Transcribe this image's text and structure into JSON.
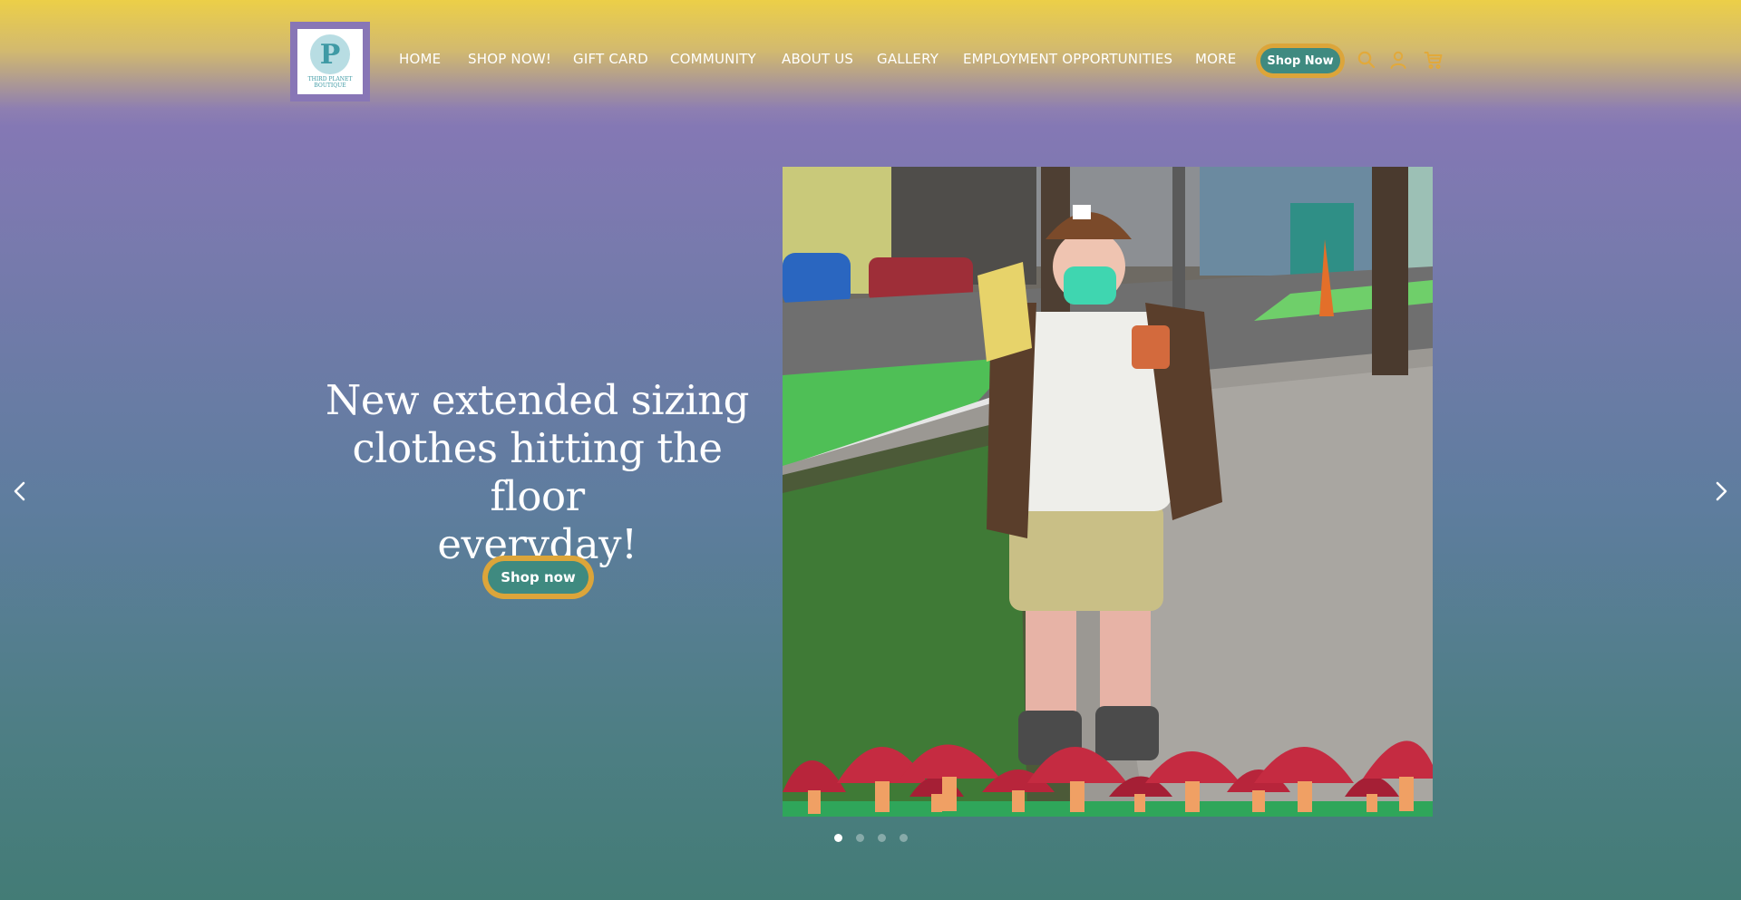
{
  "brand": {
    "logo_lines": [
      "THIRD PLANET",
      "BOUTIQUE"
    ],
    "logo_letter": "P"
  },
  "nav": {
    "items": [
      {
        "label": "HOME"
      },
      {
        "label": "SHOP NOW!"
      },
      {
        "label": "GIFT CARD"
      },
      {
        "label": "COMMUNITY"
      },
      {
        "label": "ABOUT US"
      },
      {
        "label": "GALLERY"
      },
      {
        "label": "EMPLOYMENT OPPORTUNITIES"
      },
      {
        "label": "MORE"
      }
    ],
    "cta_label": "Shop Now"
  },
  "header_icons": [
    "search-icon",
    "account-icon",
    "cart-icon"
  ],
  "hero": {
    "heading_lines": [
      "New extended sizing",
      "clothes hitting the floor",
      "everyday!"
    ],
    "cta_label": "Shop now",
    "slides_total": 4,
    "active_slide": 1
  },
  "colors": {
    "top_band": "#eccf48",
    "purple": "#8478b4",
    "teal": "#437c76",
    "button_fill": "#3f8a80",
    "button_ring": "#dca53a"
  }
}
